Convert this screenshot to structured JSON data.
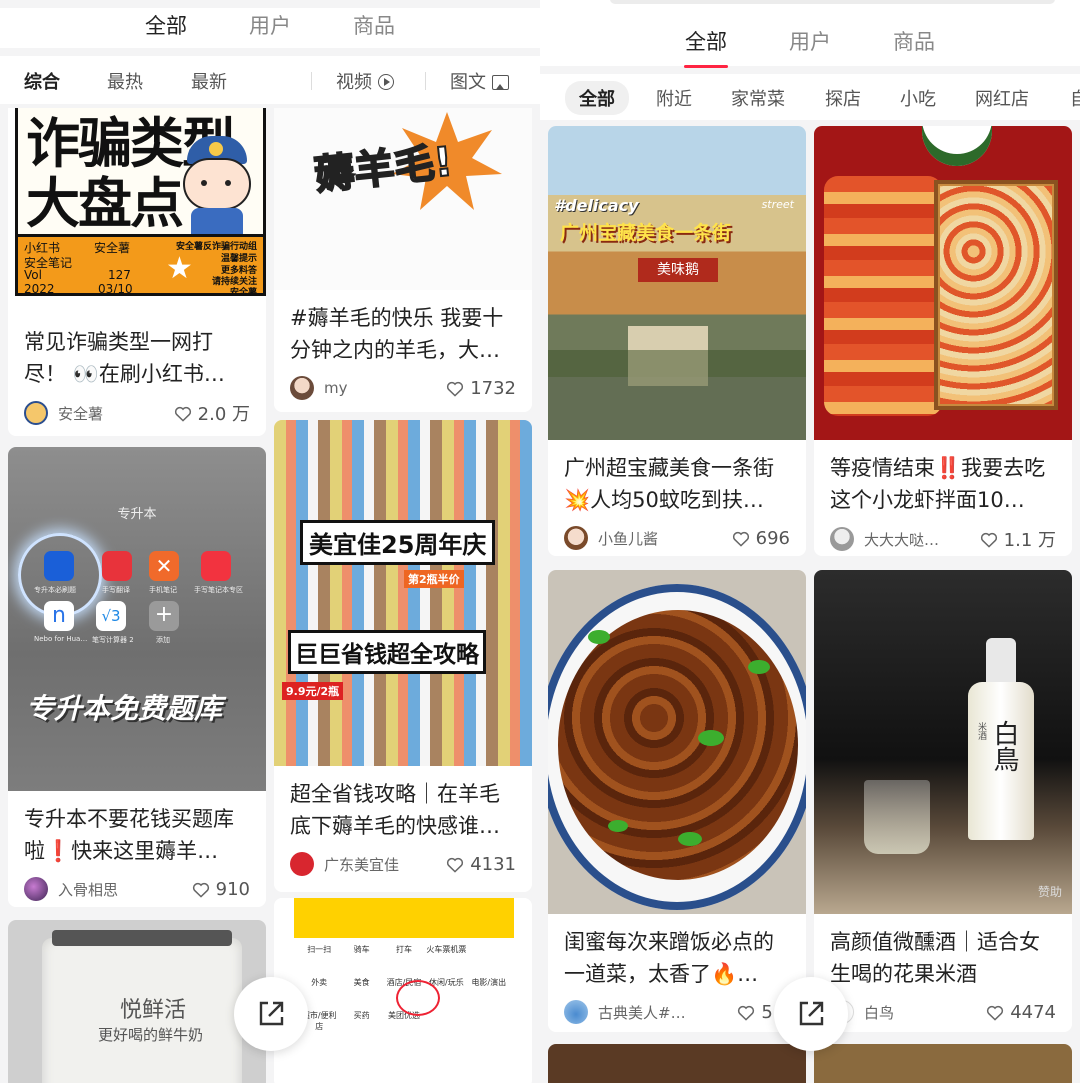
{
  "left": {
    "tabs": [
      "全部",
      "用户",
      "商品"
    ],
    "filters": {
      "sort": [
        "综合",
        "最热",
        "最新"
      ],
      "video": "视频",
      "image": "图文"
    },
    "cards": [
      {
        "cover_text": [
          "诈骗类型",
          "大盘点"
        ],
        "cover_foot": [
          "小红书",
          "安全薯",
          "安全笔记",
          "Vol",
          "127",
          "2022",
          "03/10",
          "安全薯反诈骗行动组",
          "温馨提示",
          "更多料答",
          "请持续关注",
          "安全薯"
        ],
        "title": "常见诈骗类型一网打尽！ 👀在刷小红书…",
        "author": "安全薯",
        "likes": "2.0 万"
      },
      {
        "cover_text": "薅羊毛!",
        "title": "#薅羊毛的快乐 我要十分钟之内的羊毛，大…",
        "author": "my",
        "likes": "1732"
      },
      {
        "cover_label": "专升本",
        "apps": [
          "专升本必刷题",
          "手写翻译",
          "手机笔记",
          "手写笔记本专区",
          "Nebo for Hua…",
          "笔写计算器 2",
          "添加"
        ],
        "cover_text": "专升本免费题库",
        "title": "专升本不要花钱买题库啦❗快来这里薅羊…",
        "author": "入骨相思",
        "likes": "910"
      },
      {
        "cover_text": [
          "美宜佳25周年庆",
          "巨巨省钱超全攻略"
        ],
        "cover_small": [
          "9.9元/2瓶",
          "第2瓶半价"
        ],
        "title": "超全省钱攻略｜在羊毛底下薅羊毛的快感谁…",
        "author": "广东美宜佳",
        "likes": "4131"
      },
      {
        "cover_text": [
          "悦鲜活",
          "更好喝的鲜牛奶"
        ]
      },
      {
        "cover_rows": [
          "扫一扫",
          "骑车",
          "打车",
          "火车票机票",
          "外卖",
          "美食",
          "酒店/民宿",
          "休闲/玩乐",
          "电影/演出",
          "超市/便利店",
          "买药",
          "美团优选"
        ]
      }
    ]
  },
  "right": {
    "tabs": [
      "全部",
      "用户",
      "商品"
    ],
    "categories": [
      "全部",
      "附近",
      "家常菜",
      "探店",
      "小吃",
      "网红店",
      "自"
    ],
    "cards": [
      {
        "cover_text": [
          "#delicacy",
          "广州宝藏美食一条街",
          "美味鹅",
          "street"
        ],
        "title": "广州超宝藏美食一条街💥人均50蚊吃到扶…",
        "author": "小鱼儿酱",
        "likes": "696"
      },
      {
        "title": "等疫情结束‼️我要去吃这个小龙虾拌面10…",
        "author": "大大大哒…",
        "likes": "1.1 万"
      },
      {
        "title": "闺蜜每次来蹭饭必点的一道菜，太香了🔥…",
        "author": "古典美人#…",
        "likes": "5.9"
      },
      {
        "cover_text": [
          "白鳥",
          "米酒"
        ],
        "badge": "赞助",
        "title": "高颜值微醺酒｜适合女生喝的花果米酒",
        "author": "白鸟",
        "likes": "4474"
      }
    ]
  },
  "colors": {
    "accent": "#ff2442"
  }
}
